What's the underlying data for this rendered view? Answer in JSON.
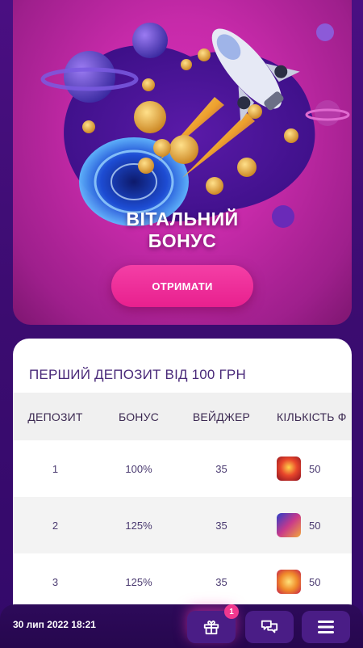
{
  "banner": {
    "title_line1": "ВІТАЛЬНИЙ",
    "title_line2": "БОНУС",
    "claim_button": "ОТРИМАТИ"
  },
  "bonus_table": {
    "title": "ПЕРШИЙ ДЕПОЗИТ ВІД 100 ГРН",
    "headers": [
      "ДЕПОЗИТ",
      "БОНУС",
      "ВЕЙДЖЕР",
      "КІЛЬКІСТЬ Ф"
    ],
    "rows": [
      {
        "deposit": "1",
        "bonus": "100%",
        "wager": "35",
        "spins": "50",
        "slot_icon": "slot-game-icon"
      },
      {
        "deposit": "2",
        "bonus": "125%",
        "wager": "35",
        "spins": "50",
        "slot_icon": "slot-game-icon"
      },
      {
        "deposit": "3",
        "bonus": "125%",
        "wager": "35",
        "spins": "50",
        "slot_icon": "slot-game-icon"
      }
    ]
  },
  "bottom_bar": {
    "datetime": "30 лип 2022 18:21",
    "gift_badge": "1",
    "icons": [
      "gift-icon",
      "chat-icon",
      "menu-icon"
    ]
  },
  "colors": {
    "accent_pink": "#e8208e",
    "banner_magenta": "#c62aa9",
    "background_purple": "#3b0c70",
    "nav_button": "#4a1d86"
  }
}
